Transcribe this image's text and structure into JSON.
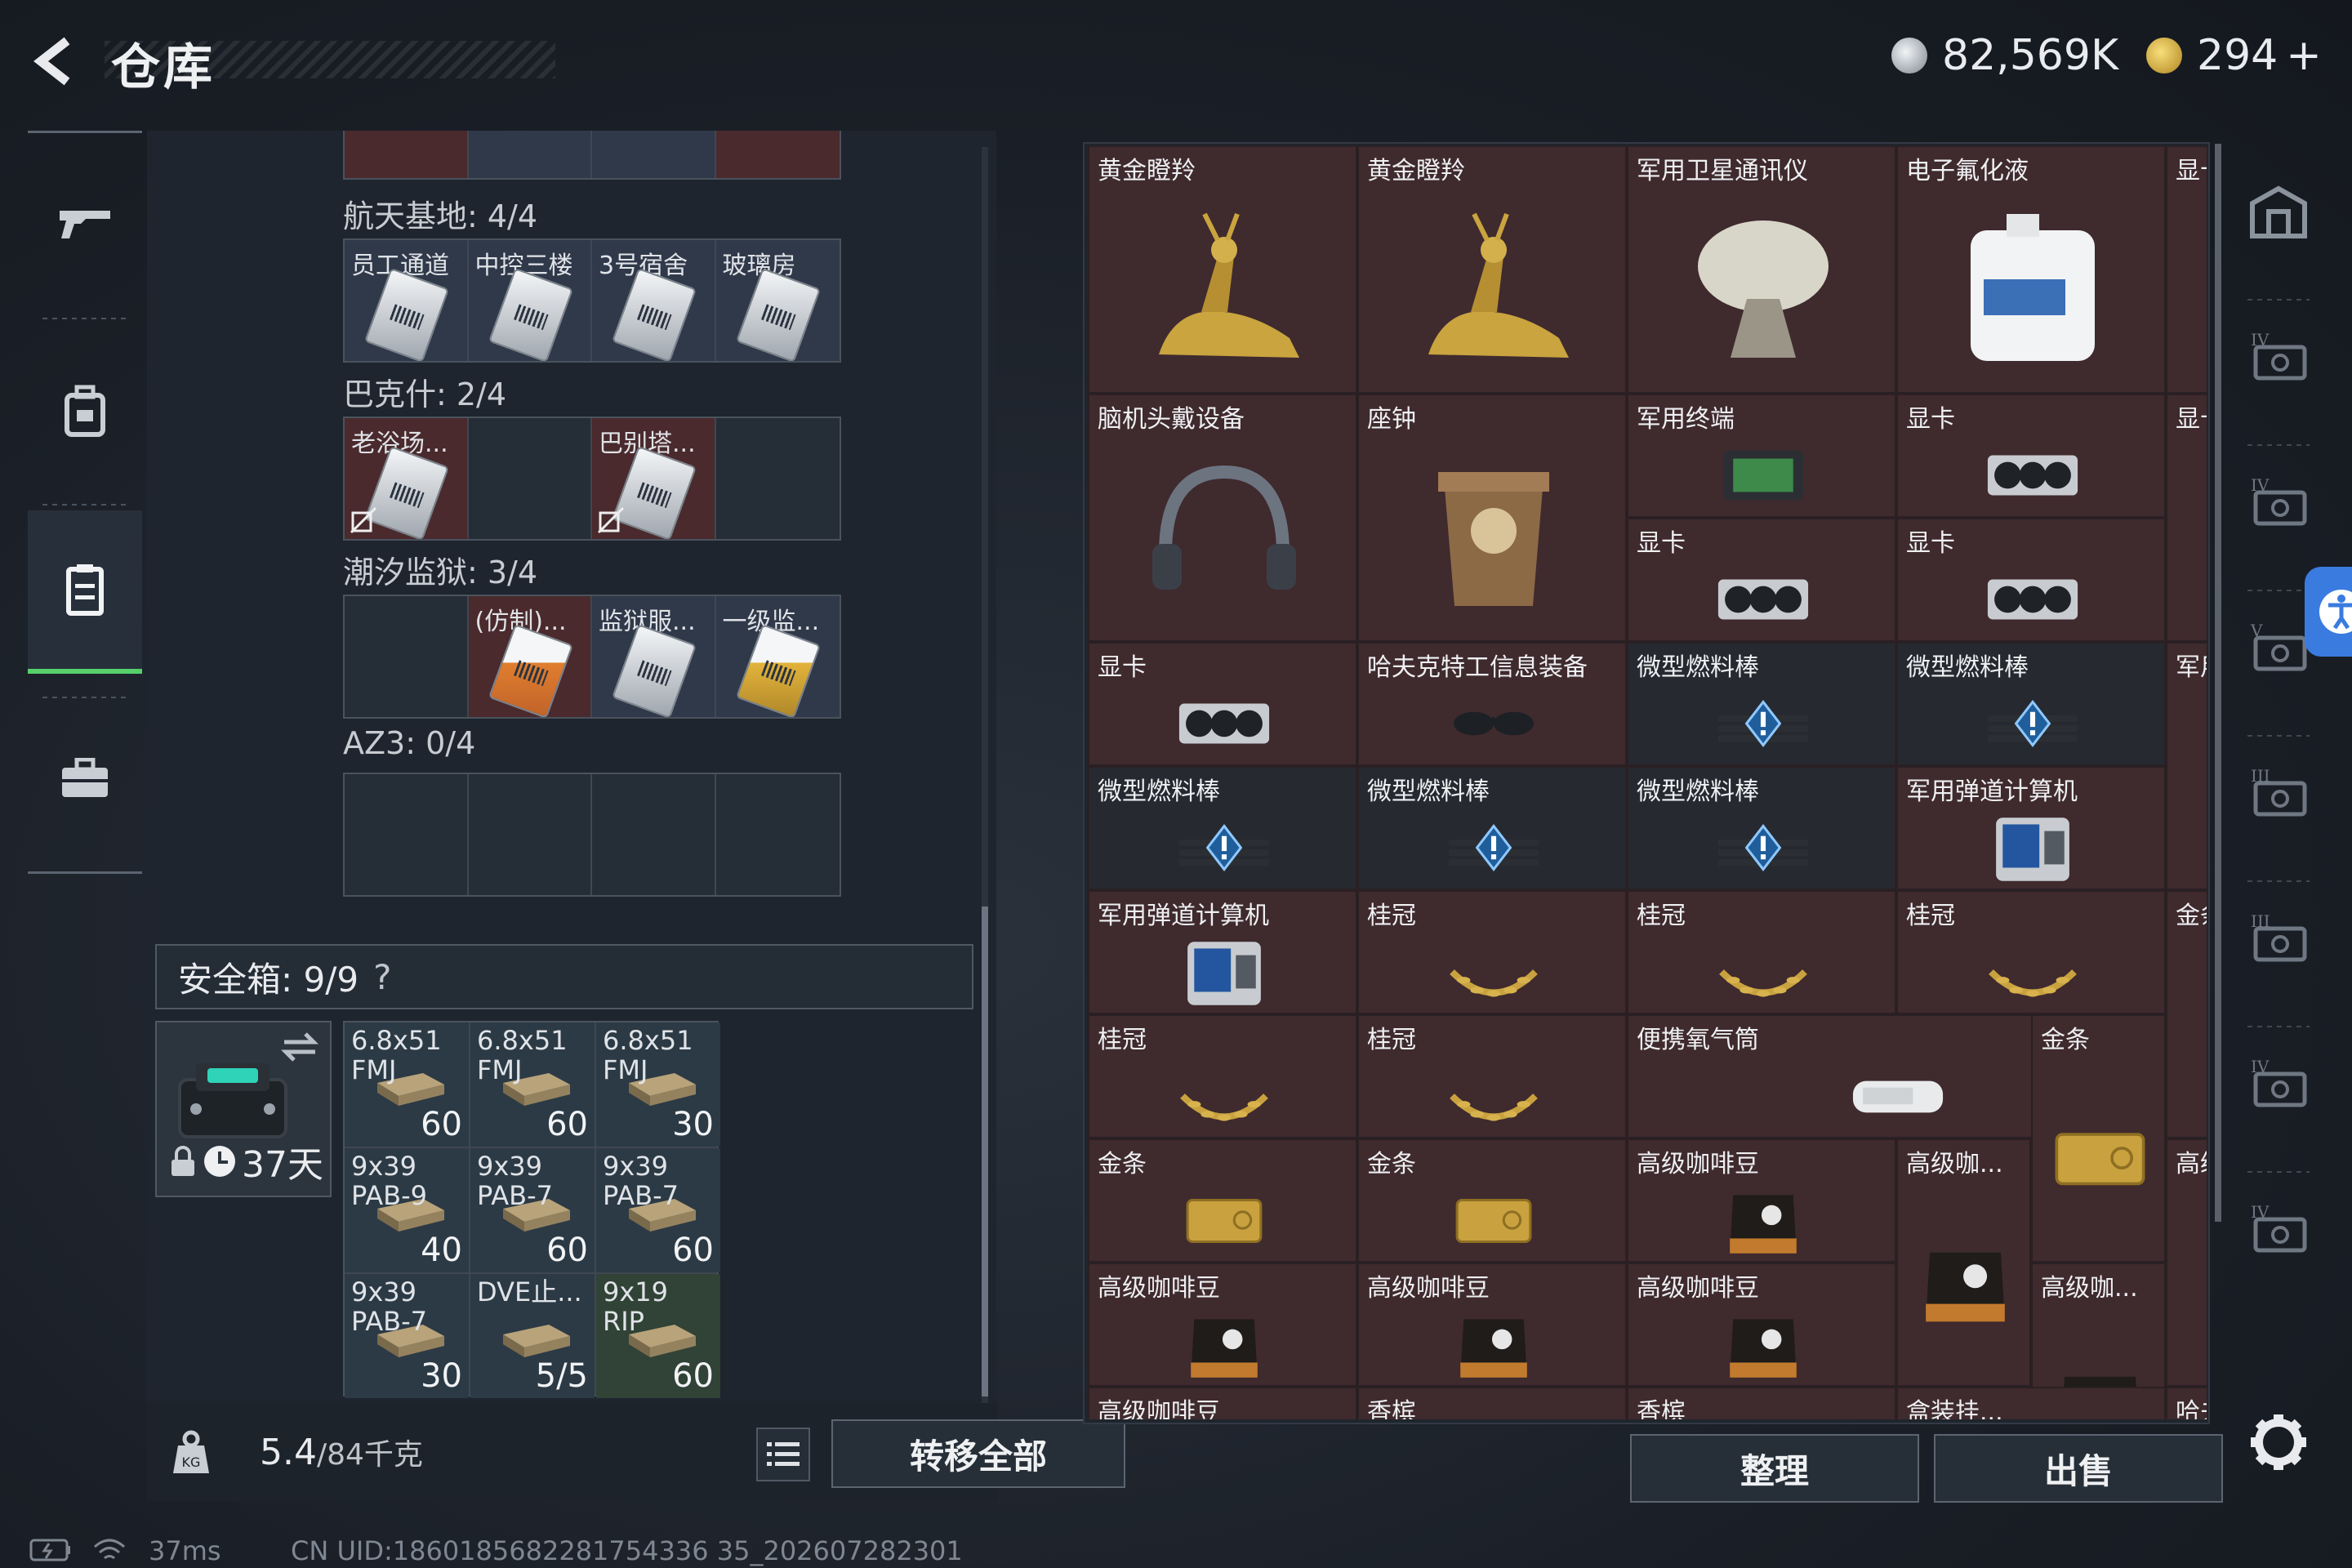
{
  "header": {
    "title": "仓库",
    "currency_1": "82,569K",
    "currency_2": "294",
    "currency_2_plus": "+"
  },
  "left_nav": [
    "weapon-icon",
    "backpack-icon",
    "storage-icon",
    "briefcase-icon"
  ],
  "key_groups": [
    {
      "title": "航天基地: 4/4",
      "cells": [
        {
          "label": "员工通道",
          "style": "blue"
        },
        {
          "label": "中控三楼",
          "style": "blue"
        },
        {
          "label": "3号宿舍",
          "style": "blue"
        },
        {
          "label": "玻璃房",
          "style": "blue"
        }
      ]
    },
    {
      "title": "巴克什: 2/4",
      "cells": [
        {
          "label": "老浴场...",
          "style": "red"
        },
        {
          "label": "",
          "style": "empty"
        },
        {
          "label": "巴别塔...",
          "style": "red"
        },
        {
          "label": "",
          "style": "empty"
        }
      ]
    },
    {
      "title": "潮汐监狱: 3/4",
      "cells": [
        {
          "label": "",
          "style": "empty"
        },
        {
          "label": "(仿制)...",
          "style": "red"
        },
        {
          "label": "监狱服...",
          "style": "blue"
        },
        {
          "label": "一级监...",
          "style": "blue"
        }
      ]
    },
    {
      "title": "AZ3: 0/4",
      "cells": [
        {
          "label": "",
          "style": "empty"
        },
        {
          "label": "",
          "style": "empty"
        },
        {
          "label": "",
          "style": "empty"
        },
        {
          "label": "",
          "style": "empty"
        }
      ]
    }
  ],
  "safebox": {
    "label": "安全箱: 9/9",
    "help": "?",
    "days": "37天",
    "ammo": [
      {
        "name": "6.8x51 FMJ",
        "count": "60",
        "style": "blue"
      },
      {
        "name": "6.8x51 FMJ",
        "count": "60",
        "style": "blue"
      },
      {
        "name": "6.8x51 FMJ",
        "count": "30",
        "style": "blue"
      },
      {
        "name": "9x39 PAB-9",
        "count": "40",
        "style": "blue"
      },
      {
        "name": "9x39 PAB-7",
        "count": "60",
        "style": "blue"
      },
      {
        "name": "9x39 PAB-7",
        "count": "60",
        "style": "blue"
      },
      {
        "name": "9x39 PAB-7",
        "count": "30",
        "style": "blue"
      },
      {
        "name": "DVE止...",
        "count": "5/5",
        "style": "blue"
      },
      {
        "name": "9x19 RIP",
        "count": "60",
        "style": "green"
      }
    ]
  },
  "weight": {
    "value": "5.4",
    "unit": "/84千克"
  },
  "buttons": {
    "transfer_all": "转移全部",
    "organize": "整理",
    "sell": "出售"
  },
  "status": {
    "ping": "37ms",
    "uid": "CN UID:1860185682281754336 35_202607282301"
  },
  "stash_items": [
    {
      "name": "黄金瞪羚",
      "icon": "gazelle-icon"
    },
    {
      "name": "黄金瞪羚",
      "icon": "gazelle-icon"
    },
    {
      "name": "军用卫星通讯仪",
      "icon": "satellite-dish-icon"
    },
    {
      "name": "电子氟化液",
      "icon": "jerrycan-icon"
    },
    {
      "name": "显卡",
      "icon": "gpu-icon"
    },
    {
      "name": "脑机头戴设备",
      "icon": "headset-icon"
    },
    {
      "name": "座钟",
      "icon": "clock-icon"
    },
    {
      "name": "军用终端",
      "icon": "terminal-icon"
    },
    {
      "name": "显卡",
      "icon": "gpu-icon"
    },
    {
      "name": "显卡",
      "icon": "gpu-icon"
    },
    {
      "name": "显卡",
      "icon": "gpu-icon"
    },
    {
      "name": "显卡",
      "icon": "gpu-icon"
    },
    {
      "name": "显卡",
      "icon": "gpu-icon"
    },
    {
      "name": "哈夫克特工信息装备",
      "icon": "glasses-icon"
    },
    {
      "name": "微型燃料棒",
      "icon": "fuel-rod-icon"
    },
    {
      "name": "微型燃料棒",
      "icon": "fuel-rod-icon"
    },
    {
      "name": "军用弹...",
      "icon": "calculator-icon"
    },
    {
      "name": "微型燃料棒",
      "icon": "fuel-rod-icon"
    },
    {
      "name": "微型燃料棒",
      "icon": "fuel-rod-icon"
    },
    {
      "name": "微型燃料棒",
      "icon": "fuel-rod-icon"
    },
    {
      "name": "军用弹道计算机",
      "icon": "calculator-icon"
    },
    {
      "name": "军用弹道计算机",
      "icon": "calculator-icon"
    },
    {
      "name": "桂冠",
      "icon": "laurel-icon"
    },
    {
      "name": "桂冠",
      "icon": "laurel-icon"
    },
    {
      "name": "桂冠",
      "icon": "laurel-icon"
    },
    {
      "name": "金条",
      "icon": "gold-bar-icon"
    },
    {
      "name": "桂冠",
      "icon": "laurel-icon"
    },
    {
      "name": "桂冠",
      "icon": "laurel-icon"
    },
    {
      "name": "便携氧气筒",
      "icon": "oxygen-icon"
    },
    {
      "name": "金条",
      "icon": "gold-bar-icon"
    },
    {
      "name": "金条",
      "icon": "gold-bar-icon"
    },
    {
      "name": "金条",
      "icon": "gold-bar-icon"
    },
    {
      "name": "高级咖啡豆",
      "icon": "coffee-icon"
    },
    {
      "name": "高级咖...",
      "icon": "coffee-icon"
    },
    {
      "name": "高级咖...",
      "icon": "coffee-icon"
    },
    {
      "name": "高级咖啡豆",
      "icon": "coffee-icon"
    },
    {
      "name": "高级咖啡豆",
      "icon": "coffee-icon"
    },
    {
      "name": "高级咖啡豆",
      "icon": "coffee-icon"
    },
    {
      "name": "高级咖...",
      "icon": "coffee-icon"
    },
    {
      "name": "高级咖啡豆",
      "icon": "coffee-icon"
    },
    {
      "name": "香槟",
      "icon": "champagne-icon"
    },
    {
      "name": "香槟",
      "icon": "champagne-icon"
    },
    {
      "name": "盒装挂...",
      "icon": "box-icon"
    },
    {
      "name": "哈夫克...",
      "icon": "item-icon"
    }
  ],
  "right_sidebar": [
    "safehouse-icon",
    "tier-iv-folder-icon",
    "tier-iv-gpu-icon",
    "tier-v-gpu-icon",
    "tier-iii-gpu-icon",
    "tier-iii-chip-icon",
    "tier-iv-medkit-icon",
    "tier-iv-vehicle-icon"
  ],
  "accent": {
    "green": "#56d06b",
    "item_red": "#3f2a2e",
    "blue": "#3a7be0"
  }
}
